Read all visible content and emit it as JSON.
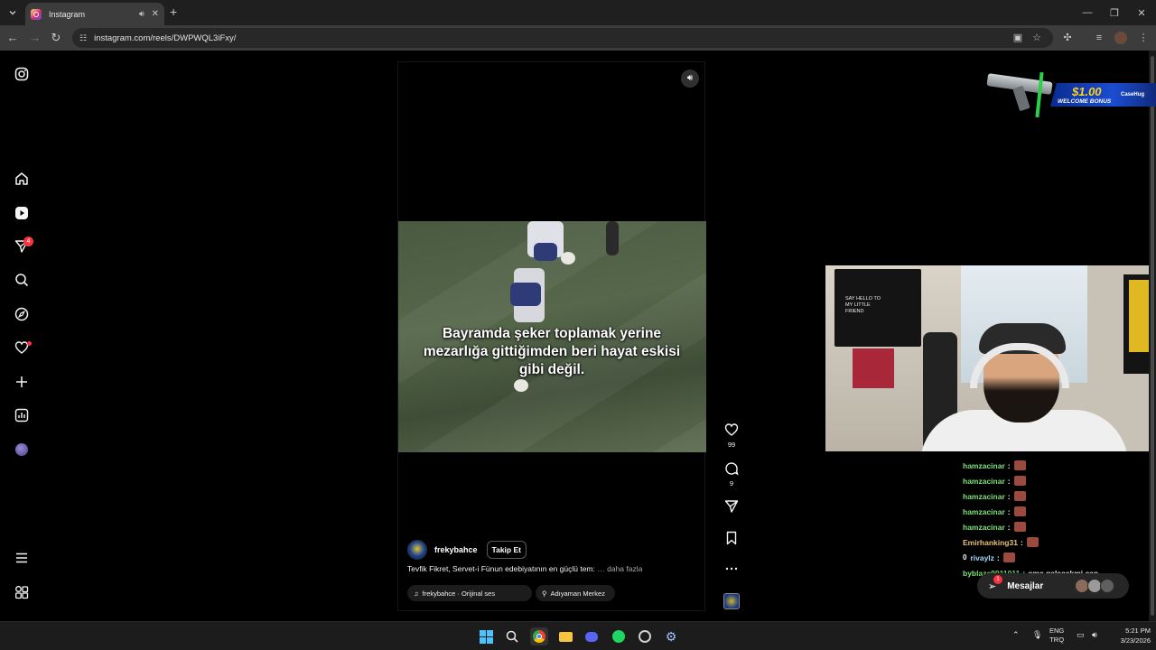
{
  "browser": {
    "tab_title": "Instagram",
    "url": "instagram.com/reels/DWPWQL3iFxy/",
    "new_tab_symbol": "+"
  },
  "sidebar": {
    "notifications_badge": "4"
  },
  "reel": {
    "caption": "Bayramda şeker toplamak yerine mezarlığa gittiğimden beri hayat eskisi gibi değil.",
    "username": "frekybahce",
    "follow_label": "Takip Et",
    "description": "Tevfik Fikret, Servet-i Fünun edebiyatının en güçlü tem:",
    "more_label": "… daha fazla",
    "audio_label": "frekybahce · Orijinal ses",
    "location_label": "Adıyaman Merkez",
    "likes_count": "99",
    "comments_count": "9"
  },
  "ad": {
    "amount": "$1.00",
    "tagline": "WELCOME BONUS",
    "brand": "CaseHug"
  },
  "webcam": {
    "poster_text": "SAY HELLO TO MY LITTLE FRIEND"
  },
  "chat": [
    {
      "user": "hamzacinar",
      "sep": ":",
      "emote": true,
      "msg": "",
      "prefix": ""
    },
    {
      "user": "hamzacinar",
      "sep": ":",
      "emote": true,
      "msg": "",
      "prefix": ""
    },
    {
      "user": "hamzacinar",
      "sep": ":",
      "emote": true,
      "msg": "",
      "prefix": ""
    },
    {
      "user": "hamzacinar",
      "sep": ":",
      "emote": true,
      "msg": "",
      "prefix": ""
    },
    {
      "user": "hamzacinar",
      "sep": ":",
      "emote": true,
      "msg": "",
      "prefix": ""
    },
    {
      "user": "Emirhanking31",
      "sep": ":",
      "emote": true,
      "msg": "",
      "prefix": ""
    },
    {
      "user": "rivaylz",
      "sep": ":",
      "emote": true,
      "msg": "",
      "prefix": "0"
    },
    {
      "user": "byblaze9911011",
      "sep": ":",
      "emote": false,
      "msg": "ome gelecekmi can",
      "prefix": ""
    }
  ],
  "chat_colors": {
    "hamzacinar": "#7fe07a",
    "Emirhanking31": "#e6c07a",
    "rivaylz": "#9fd9ff",
    "byblaze9911011": "#7fe07a"
  },
  "messages": {
    "label": "Mesajlar",
    "badge": "1"
  },
  "taskbar": {
    "lang_top": "ENG",
    "lang_bottom": "TRQ",
    "time": "5:21 PM",
    "date": "3/23/2026"
  },
  "colors": {
    "accent_red": "#ff3040",
    "chrome_bg": "#1f1f1f",
    "toolbar_bg": "#3c3c3c"
  }
}
